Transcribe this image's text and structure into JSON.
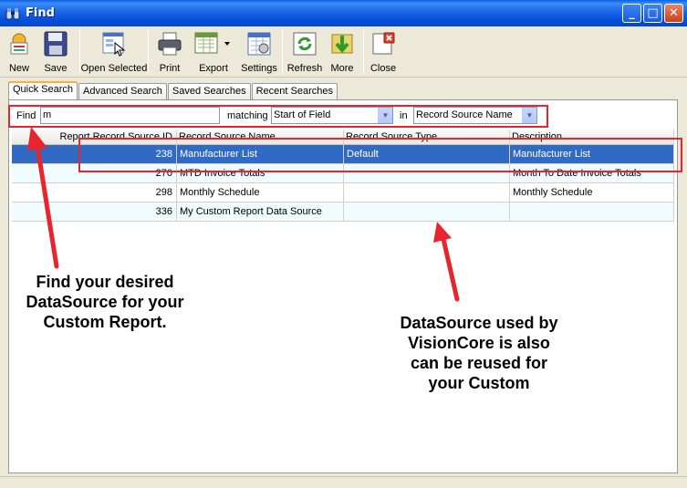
{
  "window": {
    "title": "Find"
  },
  "toolbar": {
    "new": "New",
    "save": "Save",
    "open_selected": "Open Selected",
    "print": "Print",
    "export": "Export",
    "settings": "Settings",
    "refresh": "Refresh",
    "more": "More",
    "close": "Close"
  },
  "tabs": [
    "Quick Search",
    "Advanced Search",
    "Saved Searches",
    "Recent Searches"
  ],
  "search": {
    "find_label": "Find",
    "find_value": "m",
    "matching_label": "matching",
    "matching_value": "Start of Field",
    "in_label": "in",
    "in_value": "Record Source Name"
  },
  "grid": {
    "columns": [
      "Report Record Source ID",
      "Record Source Name",
      "Record Source Type",
      "Description"
    ],
    "rows": [
      {
        "id": "238",
        "name": "Manufacturer List",
        "type": "Default",
        "description": "Manufacturer List"
      },
      {
        "id": "270",
        "name": "MTD Invoice Totals",
        "type": "",
        "description": "Month To Date Invoice Totals"
      },
      {
        "id": "298",
        "name": "Monthly Schedule",
        "type": "",
        "description": "Monthly Schedule"
      },
      {
        "id": "336",
        "name": "My Custom Report Data Source",
        "type": "",
        "description": ""
      }
    ]
  },
  "annotations": {
    "left_note": [
      "Find your desired",
      "DataSource for your",
      "Custom Report."
    ],
    "right_note": [
      "DataSource used by",
      "VisionCore is also",
      "can be reused for",
      "your Custom"
    ],
    "color": "#e8242c"
  },
  "colors": {
    "selection": "#316ac5",
    "titlebar": "#0550dc",
    "accent_tab": "#f7b23c"
  }
}
